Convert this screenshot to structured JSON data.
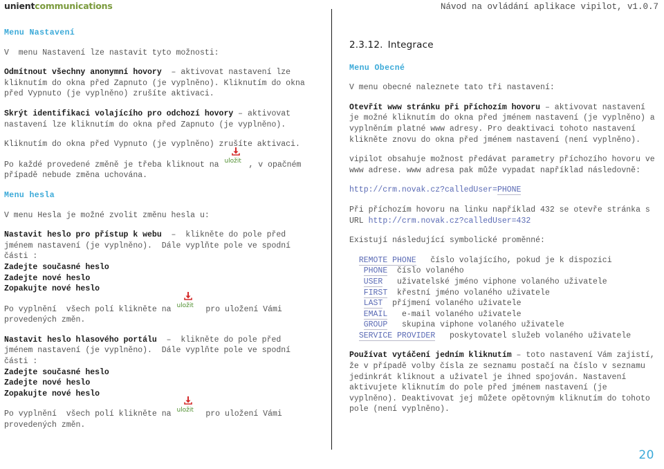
{
  "header": {
    "logo_primary": "unient",
    "logo_secondary": "communications",
    "doc_title": "Návod na ovládání aplikace vipilot, v1.0.7"
  },
  "colors": {
    "heading_blue": "#3aa9d8",
    "logo_green": "#7a9a3c",
    "code_blue": "#5b6bb5",
    "save_green": "#4f8f2f",
    "save_icon_red": "#d42a2a",
    "page_number": "#3aa9d8"
  },
  "save_button": {
    "label": "uložit",
    "icon": "download-icon"
  },
  "left": {
    "menu_heading": "Menu Nastavení",
    "intro": "V  menu Nastavení lze nastavit tyto možnosti:",
    "item1_bold": "Odmítnout všechny anonymní hovory",
    "item1_rest": "  – aktivovat nastavení lze\nkliknutím do okna před Zapnuto (je vyplněno). Kliknutím do okna\npřed Vypnuto (je vyplněno) zrušíte aktivaci.",
    "item2_bold": "Skrýt identifikaci volajícího pro odchozí hovory",
    "item2_rest": " – aktivovat\nnastavení lze kliknutím do okna před Zapnuto (je vyplněno).",
    "item2_extra": "Kliknutím do okna před Vypnuto (je vyplněno) zrušíte aktivaci.",
    "save_note_pre": "Po každé provedené změně je třeba kliknout na ",
    "save_note_post": ", v opačném\npřípadě nebude změna uchována.",
    "heslo_heading": "Menu hesla",
    "heslo_intro": "V menu Hesla je možné zvolit změnu hesla u:",
    "web_bold": "Nastavit heslo pro přístup k webu",
    "web_rest": "  –  klikněte do pole před\njménem nastavení (je vyplněno).  Dále vyplňte pole ve spodní\nčásti :",
    "fields": [
      "Zadejte současné heslo",
      "Zadejte nové heslo",
      "Zopakujte nové heslo"
    ],
    "save_note2_pre": "Po vyplnění  všech polí klikněte na ",
    "save_note2_post": " pro uložení Vámi\nprovedených změn.",
    "portal_bold": "Nastavit heslo hlasového portálu",
    "portal_rest": "  –  klikněte do pole před\njménem nastavení (je vyplněno).  Dále vyplňte pole ve spodní\nčásti :",
    "fields2": [
      "Zadejte současné heslo",
      "Zadejte nové heslo",
      "Zopakujte nové heslo"
    ],
    "save_note3_pre": "Po vyplnění  všech polí klikněte na ",
    "save_note3_post": " pro uložení Vámi\nprovedených změn."
  },
  "right": {
    "section_number": "2.3.12.",
    "section_title": "Integrace",
    "menu_heading": "Menu Obecné",
    "intro": "V menu obecné naleznete tato tři nastavení:",
    "item1_bold": "Otevřít www stránku při příchozím hovoru",
    "item1_rest": " – aktivovat nastavení\nje možné kliknutím do okna před jménem nastavení (je vyplněno) a\nvyplněním platné www adresy. Pro deaktivaci tohoto nastavení\nklikněte znovu do okna před jménem nastavení (není vyplněno).",
    "para2": "vipilot obsahuje možnost předávat parametry příchozího hovoru ve\nwww adrese. www adresa pak může vypadat například následovně:",
    "url_example_prefix": "http://crm.novak.cz?calledUser=",
    "url_example_var": "PHONE",
    "example_pre": "Při příchozím hovoru na linku například 432 se otevře stránka s\nURL ",
    "example_url": "http://crm.novak.cz?calledUser=432",
    "vars_intro": "Existují následující symbolické proměnné:",
    "variables": [
      {
        "name": "REMOTE PHONE",
        "desc": "číslo volajícího, pokud je k dispozici"
      },
      {
        "name": "PHONE",
        "desc": "číslo volaného"
      },
      {
        "name": "USER",
        "desc": "uživatelské jméno viphone volaného uživatele"
      },
      {
        "name": "FIRST",
        "desc": "křestní jméno volaného uživatele"
      },
      {
        "name": "LAST",
        "desc": "příjmení volaného uživatele"
      },
      {
        "name": "EMAIL",
        "desc": "e-mail volaného uživatele"
      },
      {
        "name": "GROUP",
        "desc": "skupina viphone volaného uživatele"
      },
      {
        "name": "SERVICE PROVIDER",
        "desc": "poskytovatel služeb volaného uživatele"
      }
    ],
    "item3_bold": "Používat vytáčení jedním kliknutím",
    "item3_rest": " – toto nastavení Vám zajistí,\nže v případě volby čísla ze seznamu postačí na číslo v seznamu\njedinkrát kliknout a uživatel je ihned spojován. Nastavení\naktivujete kliknutím do pole před jménem nastavení (je\nvyplněno). Deaktivovat jej můžete opětovným kliknutím do tohoto\npole (není vyplněno)."
  },
  "footer": {
    "page_number": "20"
  }
}
